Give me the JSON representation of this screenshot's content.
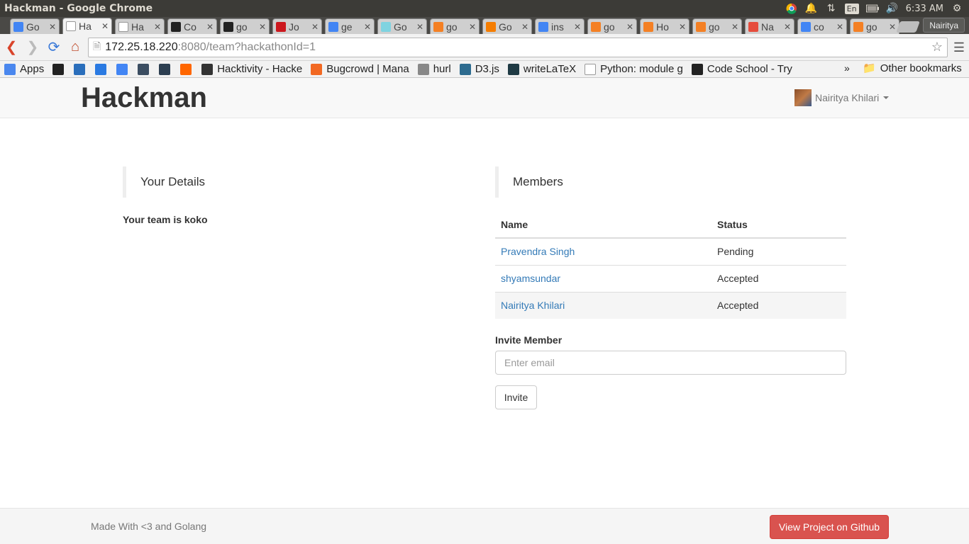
{
  "window": {
    "title": "Hackman - Google Chrome",
    "tray": {
      "language": "En",
      "time": "6:33 AM"
    }
  },
  "tabs": [
    {
      "label": "Go",
      "icon": "google-icon",
      "color": "#4285f4"
    },
    {
      "label": "Ha",
      "icon": "page-icon",
      "color": "#ffffff",
      "active": true
    },
    {
      "label": "Ha",
      "icon": "page-icon",
      "color": "#ffffff"
    },
    {
      "label": "Co",
      "icon": "github-icon",
      "color": "#222222"
    },
    {
      "label": "go",
      "icon": "github-icon",
      "color": "#222222"
    },
    {
      "label": "Jo",
      "icon": "youtube-icon",
      "color": "#cc181e"
    },
    {
      "label": "ge",
      "icon": "google-icon",
      "color": "#4285f4"
    },
    {
      "label": "Go",
      "icon": "gopher-icon",
      "color": "#7fd3e0"
    },
    {
      "label": "go",
      "icon": "stackoverflow-icon",
      "color": "#f48024"
    },
    {
      "label": "Go",
      "icon": "blogger-icon",
      "color": "#f57d00"
    },
    {
      "label": "ins",
      "icon": "google-icon",
      "color": "#4285f4"
    },
    {
      "label": "go",
      "icon": "stackoverflow-icon",
      "color": "#f48024"
    },
    {
      "label": "Ho",
      "icon": "stackoverflow-icon",
      "color": "#f48024"
    },
    {
      "label": "go",
      "icon": "stackoverflow-icon",
      "color": "#f48024"
    },
    {
      "label": "Na",
      "icon": "pinwheel-icon",
      "color": "#e64c3c"
    },
    {
      "label": "co",
      "icon": "google-icon",
      "color": "#4285f4"
    },
    {
      "label": "go",
      "icon": "stackoverflow-icon",
      "color": "#f48024"
    }
  ],
  "profile_name": "Nairitya",
  "address": {
    "host": "172.25.18.220",
    "path": ":8080/team?hackathonId=1"
  },
  "bookmarks": [
    {
      "label": "Apps",
      "icon": "apps-grid-icon",
      "color": "#4a87ee"
    },
    {
      "label": "",
      "icon": "github-icon",
      "color": "#222222"
    },
    {
      "label": "",
      "icon": "html5-icon",
      "color": "#2a6ebb"
    },
    {
      "label": "",
      "icon": "bookmark-blue-icon",
      "color": "#2a7ae2"
    },
    {
      "label": "",
      "icon": "google-icon",
      "color": "#4285f4"
    },
    {
      "label": "",
      "icon": "ideone-icon",
      "color": "#3b4d61"
    },
    {
      "label": "",
      "icon": "hackerrank-icon",
      "color": "#2c3e50"
    },
    {
      "label": "",
      "icon": "ycombinator-icon",
      "color": "#ff6600"
    },
    {
      "label": "Hacktivity - Hacke",
      "icon": "hackerone-icon",
      "color": "#333333"
    },
    {
      "label": "Bugcrowd | Mana",
      "icon": "bugcrowd-icon",
      "color": "#f26822"
    },
    {
      "label": "hurl",
      "icon": "hurl-icon",
      "color": "#888888"
    },
    {
      "label": "D3.js",
      "icon": "d3-icon",
      "color": "#2d6b8f"
    },
    {
      "label": "writeLaTeX",
      "icon": "writelatex-icon",
      "color": "#1f3a44"
    },
    {
      "label": "Python: module g",
      "icon": "page-icon",
      "color": "#ffffff"
    },
    {
      "label": "Code School - Try",
      "icon": "codeschool-icon",
      "color": "#222222"
    }
  ],
  "bookmarks_overflow": "»",
  "other_bookmarks": "Other bookmarks",
  "app": {
    "brand": "Hackman",
    "user_name": "Nairitya Khilari"
  },
  "details": {
    "heading": "Your Details",
    "team_line": "Your team is koko"
  },
  "members": {
    "heading": "Members",
    "columns": [
      "Name",
      "Status"
    ],
    "rows": [
      {
        "name": "Pravendra Singh",
        "status": "Pending"
      },
      {
        "name": "shyamsundar",
        "status": "Accepted"
      },
      {
        "name": "Nairitya Khilari",
        "status": "Accepted"
      }
    ]
  },
  "invite": {
    "label": "Invite Member",
    "placeholder": "Enter email",
    "button": "Invite"
  },
  "footer": {
    "text": "Made With <3 and Golang",
    "github_button": "View Project on Github"
  },
  "colors": {
    "link": "#337ab7",
    "danger": "#d9534f"
  }
}
